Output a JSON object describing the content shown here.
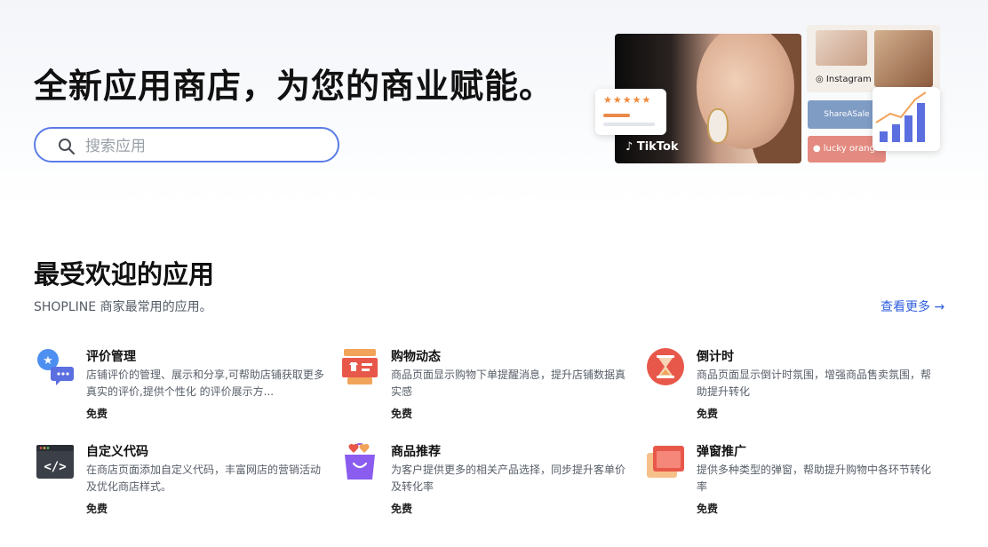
{
  "hero": {
    "headline": "全新应用商店，为您的商业赋能。",
    "search_placeholder": "搜索应用",
    "collage": {
      "tiktok_label": "TikTok",
      "instagram_label": "Instagram",
      "shareasale_label": "ShareASale",
      "lucky_label": "lucky orange",
      "rating_stars": "★★★★★"
    }
  },
  "section": {
    "title": "最受欢迎的应用",
    "subtitle": "SHOPLINE 商家最常用的应用。",
    "more_link": "查看更多 →"
  },
  "apps": [
    {
      "name": "评价管理",
      "desc": "店铺评价的管理、展示和分享,可帮助店铺获取更多真实的评价,提供个性化 的评价展示方...",
      "price": "免费",
      "icon": "review-icon"
    },
    {
      "name": "购物动态",
      "desc": "商品页面显示购物下单提醒消息，提升店铺数据真实感",
      "price": "免费",
      "icon": "shopping-feed-icon"
    },
    {
      "name": "倒计时",
      "desc": "商品页面显示倒计时氛围，增强商品售卖氛围，帮助提升转化",
      "price": "免费",
      "icon": "hourglass-icon"
    },
    {
      "name": "自定义代码",
      "desc": "在商店页面添加自定义代码，丰富网店的营销活动及优化商店样式。",
      "price": "免费",
      "icon": "code-icon"
    },
    {
      "name": "商品推荐",
      "desc": "为客户提供更多的相关产品选择，同步提升客单价及转化率",
      "price": "免费",
      "icon": "shopping-bag-icon"
    },
    {
      "name": "弹窗推广",
      "desc": "提供多种类型的弹窗，帮助提升购物中各环节转化率",
      "price": "免费",
      "icon": "popup-icon"
    }
  ],
  "colors": {
    "accent": "#2f5ee0",
    "search_border": "#5b7ce6"
  }
}
